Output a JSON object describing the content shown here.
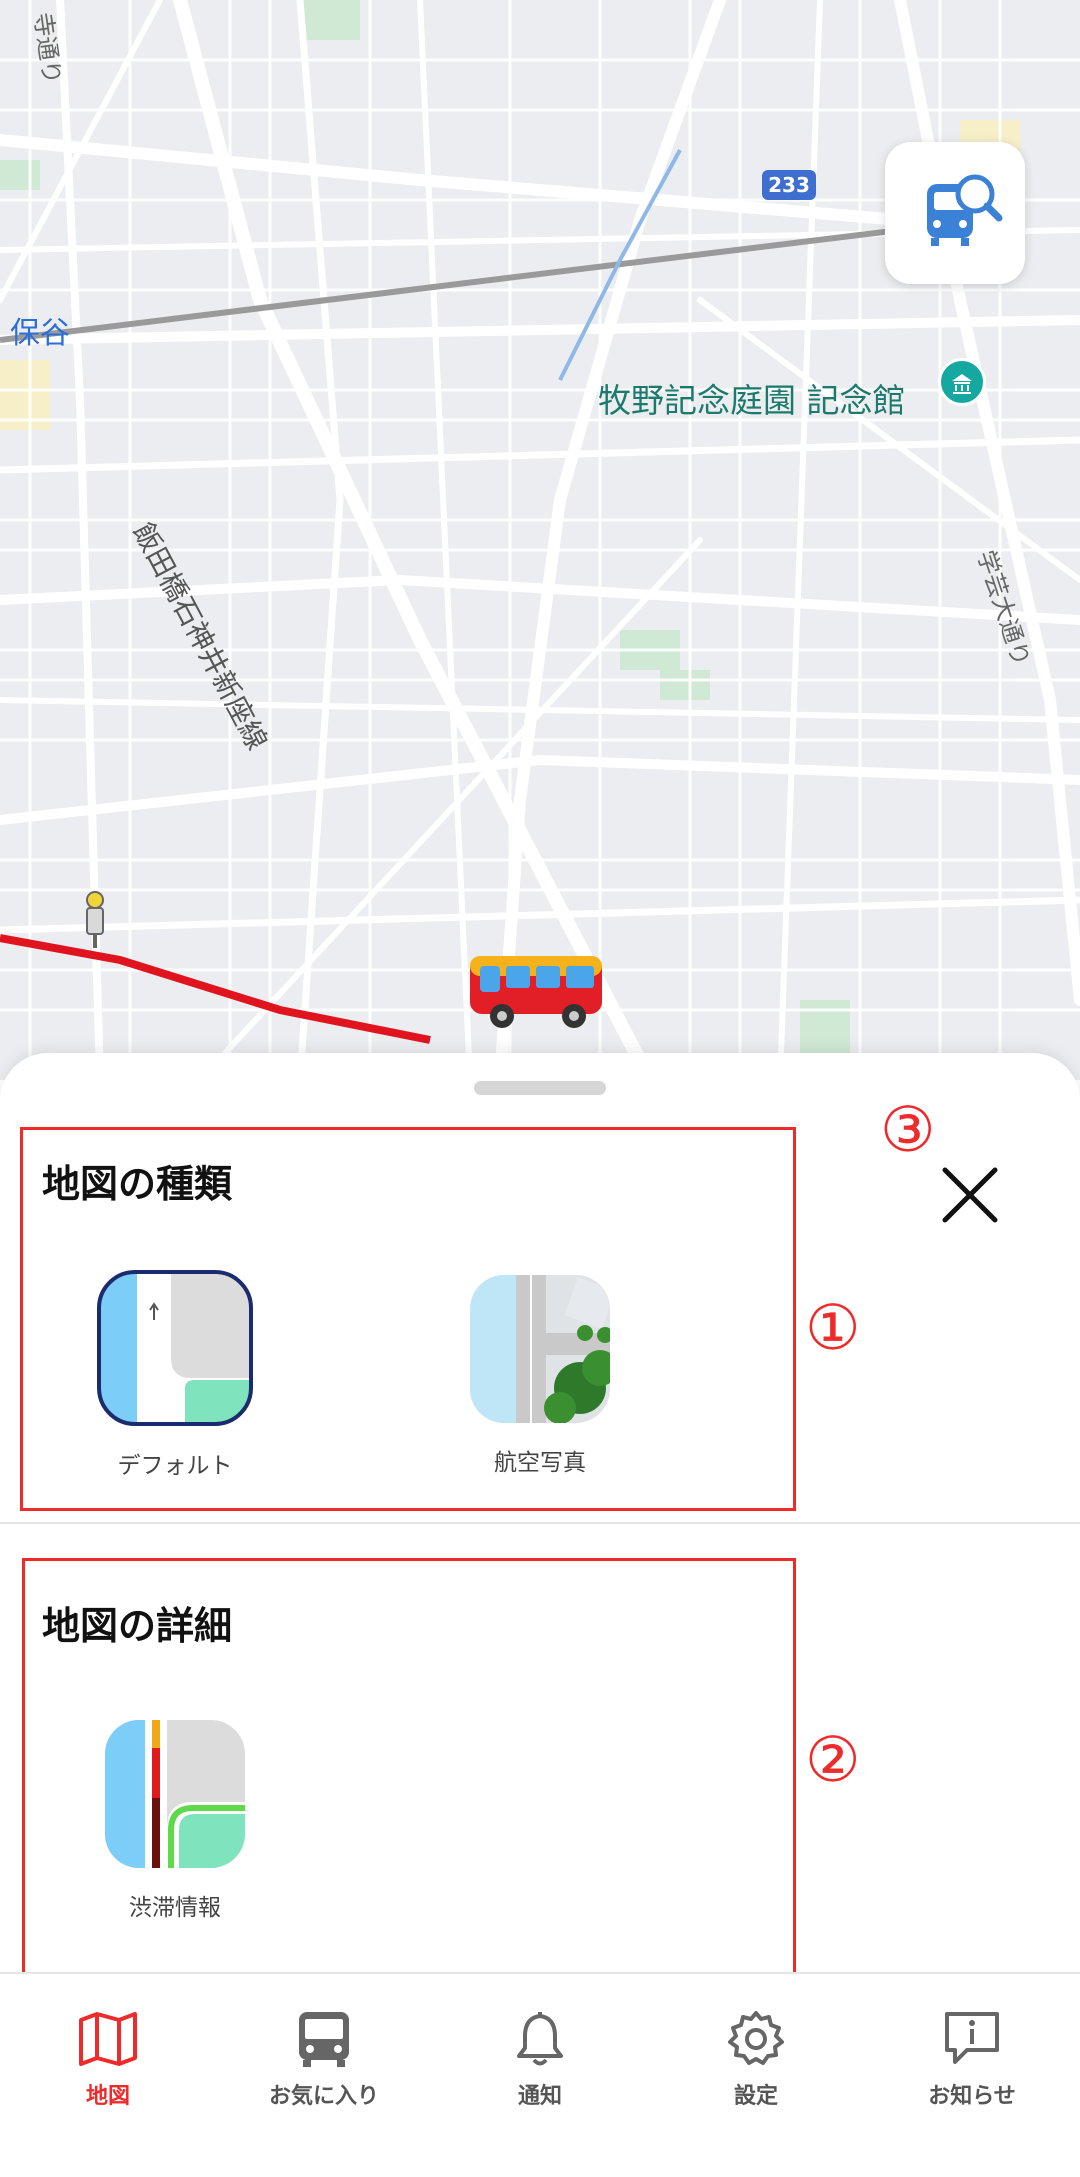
{
  "map": {
    "station_hotaya": "保谷",
    "museum": "牧野記念庭園 記念館",
    "rail_line": "飯田橋石神井新座線",
    "gakugei_street": "学芸大通り",
    "street_partial": "寺通り",
    "route_number": "233"
  },
  "sheet": {
    "section1_title": "地図の種類",
    "option_default": "デフォルト",
    "option_aerial": "航空写真",
    "section2_title": "地図の詳細",
    "option_traffic": "渋滞情報",
    "marker1": "①",
    "marker2": "②",
    "marker3": "③"
  },
  "tabs": [
    {
      "label": "地図",
      "icon": "map-icon",
      "active": true
    },
    {
      "label": "お気に入り",
      "icon": "bus-icon",
      "active": false
    },
    {
      "label": "通知",
      "icon": "bell-icon",
      "active": false
    },
    {
      "label": "設定",
      "icon": "gear-icon",
      "active": false
    },
    {
      "label": "お知らせ",
      "icon": "info-icon",
      "active": false
    }
  ],
  "colors": {
    "accent": "#ef2a2a",
    "route_line": "#e0141e",
    "map_background": "#ecedf0"
  }
}
